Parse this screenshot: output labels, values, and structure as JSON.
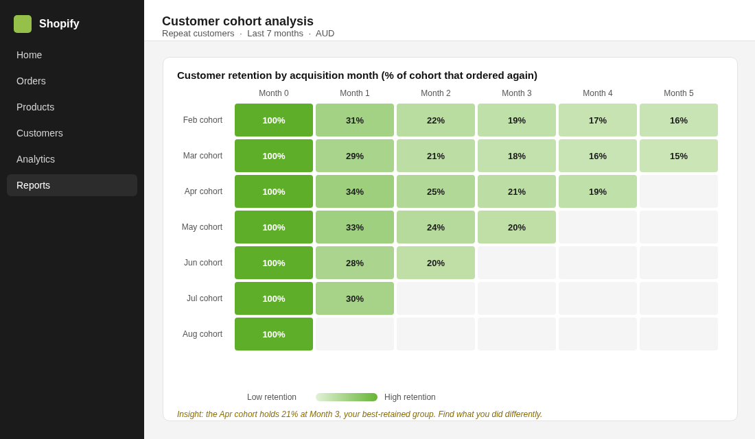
{
  "sidebar": {
    "brand": "Shopify",
    "items": [
      {
        "label": "Home",
        "selected": false
      },
      {
        "label": "Orders",
        "selected": false
      },
      {
        "label": "Products",
        "selected": false
      },
      {
        "label": "Customers",
        "selected": false
      },
      {
        "label": "Analytics",
        "selected": false
      },
      {
        "label": "Reports",
        "selected": true
      }
    ]
  },
  "header": {
    "title": "Customer cohort analysis",
    "subtitle": "Repeat customers  ·  Last 7 months  ·  AUD"
  },
  "card": {
    "title": "Customer retention by acquisition month (% of cohort that ordered again)",
    "heatmap": {
      "columns": [
        "Month 0",
        "Month 1",
        "Month 2",
        "Month 3",
        "Month 4",
        "Month 5"
      ],
      "rows": [
        {
          "label": "Feb cohort",
          "cells": [
            {
              "value": "100%",
              "color": "#5fae29"
            },
            {
              "value": "31%",
              "color": "#a3d285"
            },
            {
              "value": "22%",
              "color": "#b9dca1"
            },
            {
              "value": "19%",
              "color": "#c0e0a9"
            },
            {
              "value": "17%",
              "color": "#c6e3b1"
            },
            {
              "value": "16%",
              "color": "#c8e4b4"
            }
          ]
        },
        {
          "label": "Mar cohort",
          "cells": [
            {
              "value": "100%",
              "color": "#5fae29"
            },
            {
              "value": "29%",
              "color": "#a8d48b"
            },
            {
              "value": "21%",
              "color": "#bcdda4"
            },
            {
              "value": "18%",
              "color": "#c3e1ad"
            },
            {
              "value": "16%",
              "color": "#c8e4b4"
            },
            {
              "value": "15%",
              "color": "#cbe5b7"
            }
          ]
        },
        {
          "label": "Apr cohort",
          "cells": [
            {
              "value": "100%",
              "color": "#5fae29"
            },
            {
              "value": "34%",
              "color": "#9dcf7d"
            },
            {
              "value": "25%",
              "color": "#b2d898"
            },
            {
              "value": "21%",
              "color": "#bcdda4"
            },
            {
              "value": "19%",
              "color": "#c0e0a9"
            }
          ]
        },
        {
          "label": "May cohort",
          "cells": [
            {
              "value": "100%",
              "color": "#5fae29"
            },
            {
              "value": "33%",
              "color": "#9fd07f"
            },
            {
              "value": "24%",
              "color": "#b5da9b"
            },
            {
              "value": "20%",
              "color": "#bfdfa7"
            }
          ]
        },
        {
          "label": "Jun cohort",
          "cells": [
            {
              "value": "100%",
              "color": "#5fae29"
            },
            {
              "value": "28%",
              "color": "#abd58e"
            },
            {
              "value": "20%",
              "color": "#bfdfa7"
            }
          ]
        },
        {
          "label": "Jul cohort",
          "cells": [
            {
              "value": "100%",
              "color": "#5fae29"
            },
            {
              "value": "30%",
              "color": "#a6d388"
            }
          ]
        },
        {
          "label": "Aug cohort",
          "cells": [
            {
              "value": "100%",
              "color": "#5fae29"
            }
          ]
        }
      ]
    },
    "legend": {
      "low": "Low retention",
      "high": "High retention"
    },
    "insight": "Insight: the Apr cohort holds 21% at Month 3, your best-retained group. Find what you did differently."
  }
}
